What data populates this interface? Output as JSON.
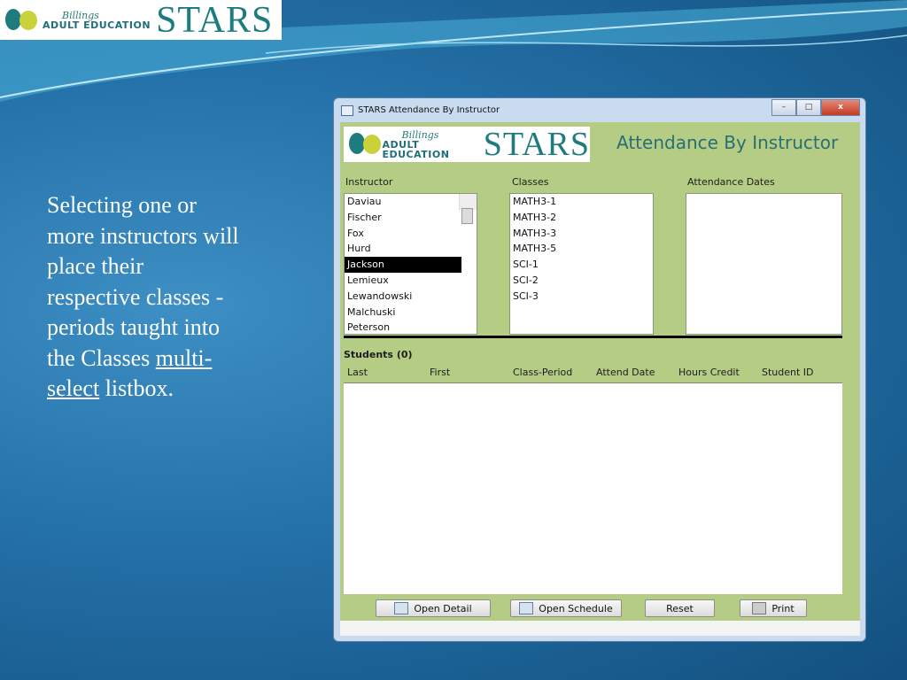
{
  "slide": {
    "logo": {
      "billings": "Billings",
      "adult_education": "ADULT EDUCATION",
      "stars": "STARS"
    },
    "body_text_before": "Selecting one or more instructors will place their respective classes - periods taught into the Classes ",
    "body_text_link": "multi-select",
    "body_text_after": " listbox."
  },
  "window": {
    "title": "STARS Attendance By Instructor",
    "minimize": "–",
    "maximize": "□",
    "close": "x",
    "form_title": "Attendance By Instructor",
    "instructor_label": "Instructor",
    "classes_label": "Classes",
    "dates_label": "Attendance Dates",
    "instructors": [
      "Daviau",
      "Fischer",
      "Fox",
      "Hurd",
      "Jackson",
      "Lemieux",
      "Lewandowski",
      "Malchuski",
      "Peterson"
    ],
    "selected_instructor": "Jackson",
    "classes": [
      "MATH3-1",
      "MATH3-2",
      "MATH3-3",
      "MATH3-5",
      "SCI-1",
      "SCI-2",
      "SCI-3"
    ],
    "students_label": "Students (0)",
    "columns": [
      "Last",
      "First",
      "Class-Period",
      "Attend Date",
      "Hours Credit",
      "Student ID"
    ],
    "buttons": {
      "open_detail": "Open Detail",
      "open_schedule": "Open Schedule",
      "reset": "Reset",
      "print": "Print"
    }
  },
  "colors": {
    "panel": "#b5cc85",
    "title": "#2a6e75"
  }
}
